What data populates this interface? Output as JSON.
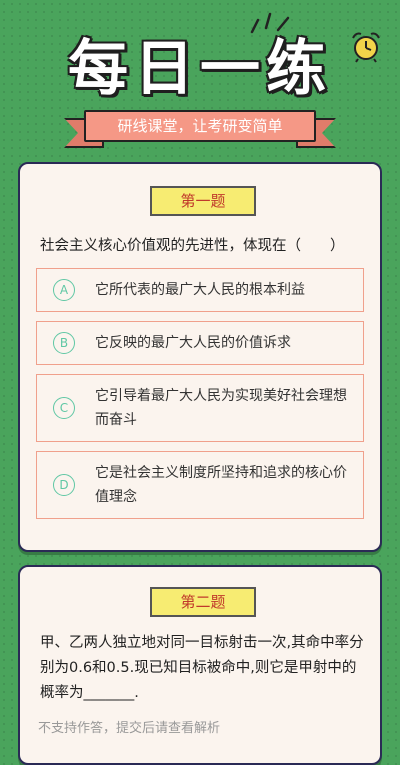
{
  "header": {
    "title": "每日一练",
    "subtitle": "研线课堂，让考研变简单"
  },
  "questions": [
    {
      "badge": "第一题",
      "text": "社会主义核心价值观的先进性，体现在（　　）",
      "options": [
        {
          "letter": "A",
          "text": "它所代表的最广大人民的根本利益"
        },
        {
          "letter": "B",
          "text": "它反映的最广大人民的价值诉求"
        },
        {
          "letter": "C",
          "text": "它引导着最广大人民为实现美好社会理想而奋斗"
        },
        {
          "letter": "D",
          "text": "它是社会主义制度所坚持和追求的核心价值理念"
        }
      ]
    },
    {
      "badge": "第二题",
      "text": "甲、乙两人独立地对同一目标射击一次,其命中率分别为0.6和0.5.现已知目标被命中,则它是甲射中的概率为_______.",
      "note": "不支持作答，提交后请查看解析"
    }
  ],
  "colors": {
    "background": "#4aa45c",
    "card": "#fbf4ee",
    "ribbon": "#f59886",
    "badge": "#f7ec72",
    "badge_text": "#c0392b",
    "option_border": "#f0a08c",
    "option_letter": "#5fc7a4"
  },
  "icons": [
    "sparkle-icon",
    "alarm-clock-icon"
  ]
}
